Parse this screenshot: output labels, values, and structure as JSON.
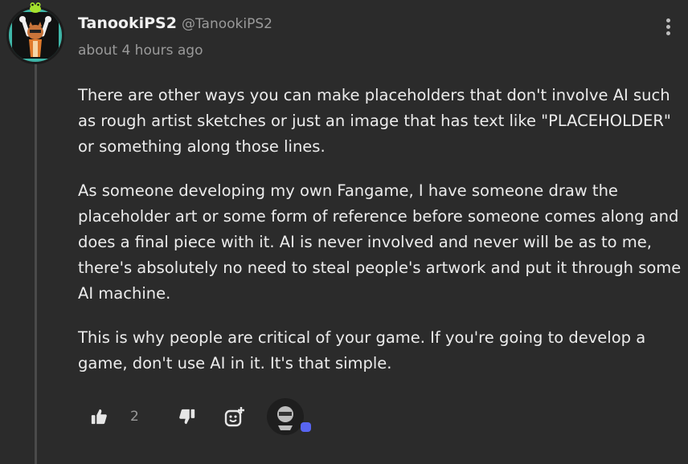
{
  "comment": {
    "username": "TanookiPS2",
    "handle": "@TanookiPS2",
    "timestamp": "about 4 hours ago",
    "paragraphs": [
      "There are other ways you can make placeholders that don't involve AI such as rough artist sketches or just an image that has text like \"PLACEHOLDER\" or something along those lines.",
      "As someone developing my own Fangame, I have someone draw the placeholder art or some form of reference before someone comes along and does a final piece with it. AI is never involved and never will be as to me, there's absolutely no need to steal people's artwork and put it through some AI machine.",
      "This is why people are critical of your game. If you're going to develop a game, don't use AI in it. It's that simple."
    ],
    "likes": "2"
  },
  "icons": {
    "more": "more-options-icon",
    "like": "thumbs-up-icon",
    "dislike": "thumbs-down-icon",
    "react": "add-reaction-icon"
  },
  "colors": {
    "background": "#2b2b2b",
    "text": "#ececec",
    "muted": "#9a9a9a",
    "badge": "#5865f2"
  }
}
